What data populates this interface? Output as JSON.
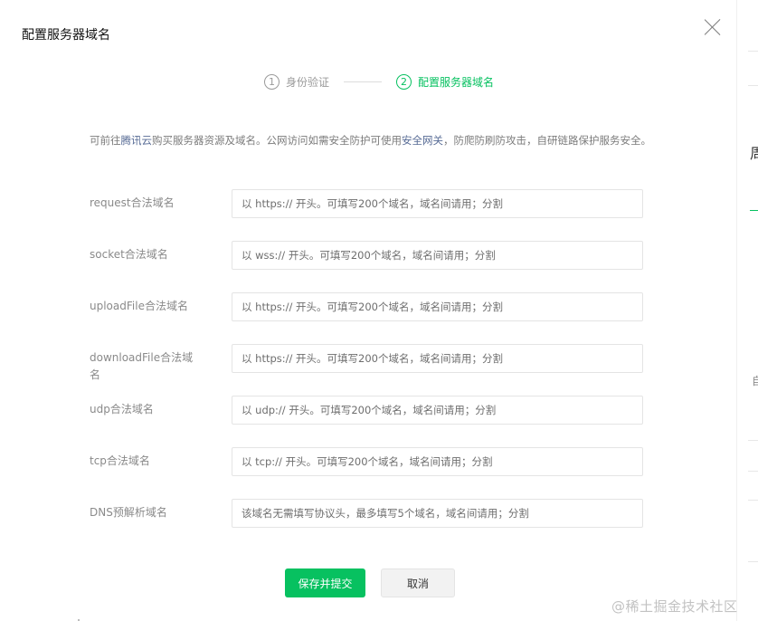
{
  "dialog": {
    "title": "配置服务器域名",
    "close_icon": "close-icon"
  },
  "steps": [
    {
      "number": "1",
      "label": "身份验证",
      "state": "done"
    },
    {
      "number": "2",
      "label": "配置服务器域名",
      "state": "active"
    }
  ],
  "description": {
    "part1": "可前往",
    "link1": "腾讯云",
    "part2": "购买服务器资源及域名。公网访问如需安全防护可使用",
    "link2": "安全网关",
    "part3": "，防爬防刷防攻击，自研链路保护服务安全。"
  },
  "fields": [
    {
      "label": "request合法域名",
      "value": "",
      "placeholder": "以 https:// 开头。可填写200个域名，域名间请用；分割"
    },
    {
      "label": "socket合法域名",
      "value": "",
      "placeholder": "以 wss:// 开头。可填写200个域名，域名间请用；分割"
    },
    {
      "label": "uploadFile合法域名",
      "value": "",
      "placeholder": "以 https:// 开头。可填写200个域名，域名间请用；分割"
    },
    {
      "label": "downloadFile合法域名",
      "value": "",
      "placeholder": "以 https:// 开头。可填写200个域名，域名间请用；分割"
    },
    {
      "label": "udp合法域名",
      "value": "",
      "placeholder": "以 udp:// 开头。可填写200个域名，域名间请用；分割"
    },
    {
      "label": "tcp合法域名",
      "value": "",
      "placeholder": "以 tcp:// 开头。可填写200个域名，域名间请用；分割"
    },
    {
      "label": "DNS预解析域名",
      "value": "",
      "placeholder": "该域名无需填写协议头，最多填写5个域名，域名间请用；分割"
    }
  ],
  "buttons": {
    "submit": "保存并提交",
    "cancel": "取消"
  },
  "background_page": {
    "glyph_top": "周",
    "glyph_mid": "自"
  },
  "watermark": "@稀土掘金技术社区",
  "colors": {
    "accent": "#07c160",
    "link": "#576b95"
  }
}
